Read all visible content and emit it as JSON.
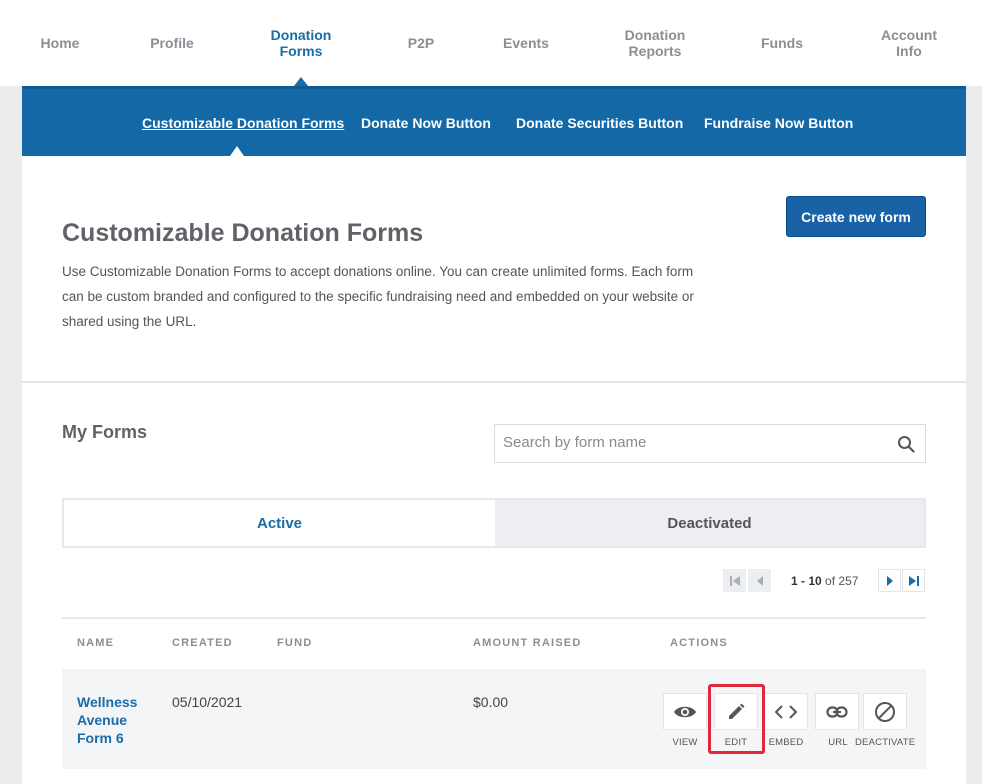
{
  "topnav": {
    "items": [
      {
        "label": "Home"
      },
      {
        "label": "Profile"
      },
      {
        "label": "Donation Forms"
      },
      {
        "label": "P2P"
      },
      {
        "label": "Events"
      },
      {
        "label": "Donation Reports"
      },
      {
        "label": "Funds"
      },
      {
        "label": "Account Info"
      }
    ],
    "active_index": 2
  },
  "subnav": {
    "items": [
      {
        "label": "Customizable Donation Forms"
      },
      {
        "label": "Donate Now Button"
      },
      {
        "label": "Donate Securities Button"
      },
      {
        "label": "Fundraise Now Button"
      }
    ],
    "active_index": 0
  },
  "page": {
    "title": "Customizable Donation Forms",
    "description": "Use Customizable Donation Forms to accept donations online. You can create unlimited forms. Each form can be custom branded and configured to the specific fundraising need and embedded on your website or shared using the URL.",
    "create_button": "Create new form"
  },
  "my_forms": {
    "heading": "My Forms",
    "search_placeholder": "Search by form name",
    "tabs": {
      "active": "Active",
      "deactivated": "Deactivated"
    },
    "pagination": {
      "range": "1 - 10",
      "of": "of",
      "total": "257"
    }
  },
  "table": {
    "headers": {
      "name": "NAME",
      "created": "CREATED",
      "fund": "FUND",
      "amount": "AMOUNT RAISED",
      "actions": "ACTIONS"
    },
    "rows": [
      {
        "name": "Wellness Avenue Form 6",
        "created": "05/10/2021",
        "fund": "",
        "amount": "$0.00"
      }
    ],
    "actions": {
      "view": "VIEW",
      "edit": "EDIT",
      "embed": "EMBED",
      "url": "URL",
      "deactivate": "DEACTIVATE"
    }
  },
  "colors": {
    "primary": "#1568a6",
    "highlight": "#e0283c"
  }
}
